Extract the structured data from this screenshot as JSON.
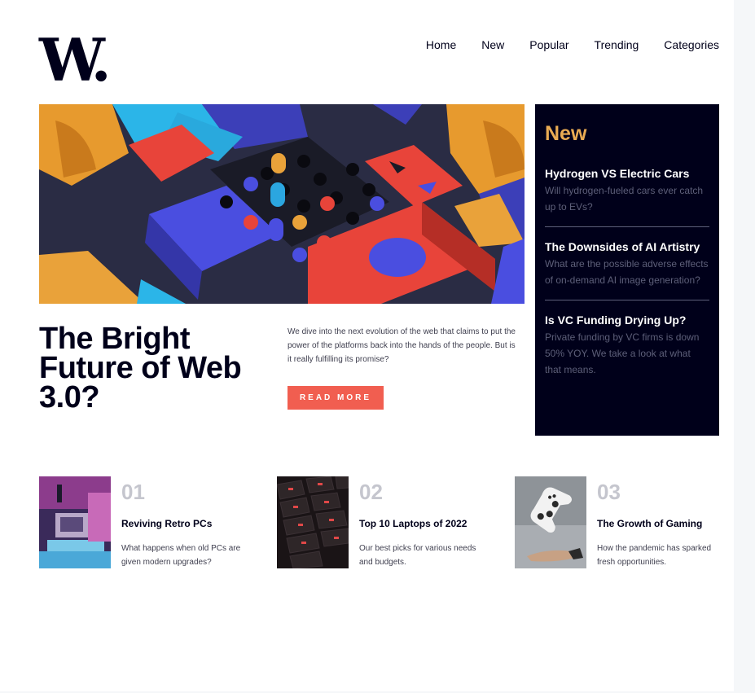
{
  "logo": {
    "text": "W."
  },
  "nav": {
    "items": [
      "Home",
      "New",
      "Popular",
      "Trending",
      "Categories"
    ]
  },
  "hero": {
    "title": "The Bright Future of Web 3.0?",
    "description": "We dive into the next evolution of the web that claims to put the power of the platforms back into the hands of the people. But is it really fulfilling its promise?",
    "cta": "READ MORE"
  },
  "new_panel": {
    "title": "New",
    "items": [
      {
        "title": "Hydrogen VS Electric Cars",
        "desc": "Will hydrogen-fueled cars ever catch up to EVs?"
      },
      {
        "title": "The Downsides of AI Artistry",
        "desc": "What are the possible adverse effects of on-demand AI image generation?"
      },
      {
        "title": "Is VC Funding Drying Up?",
        "desc": "Private funding by VC firms is down 50% YOY. We take a look at what that means."
      }
    ]
  },
  "cards": [
    {
      "num": "01",
      "title": "Reviving Retro PCs",
      "desc": "What happens when old PCs are given modern upgrades?"
    },
    {
      "num": "02",
      "title": "Top 10 Laptops of 2022",
      "desc": "Our best picks for various needs and budgets."
    },
    {
      "num": "03",
      "title": "The Growth of Gaming",
      "desc": "How the pandemic has sparked fresh opportunities."
    }
  ],
  "colors": {
    "accent_orange": "#e9ab53",
    "cta_red": "#f15e50",
    "dark_navy": "#00001a",
    "muted_number": "#c5c6ce"
  }
}
